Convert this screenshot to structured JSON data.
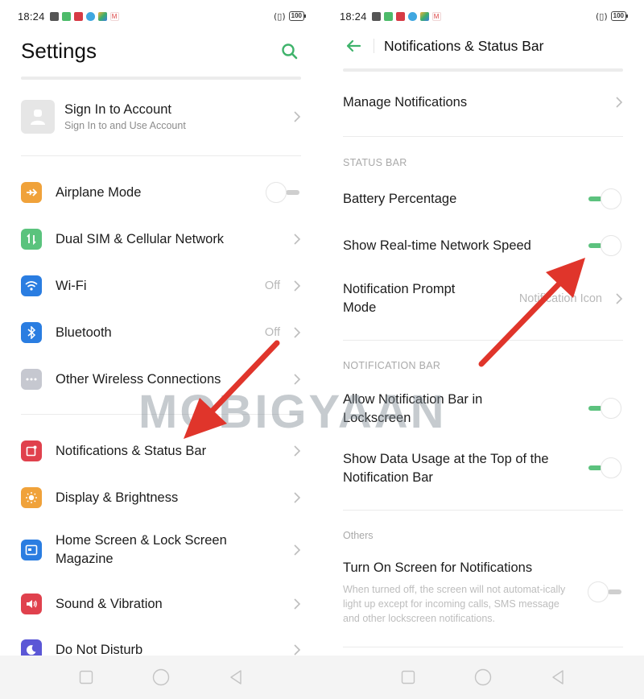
{
  "colors": {
    "accent_green": "#3fb36b",
    "toggle_on": "#5cc27e",
    "toggle_off": "#cfcfcf",
    "arrow_red": "#e0352b"
  },
  "status_bar": {
    "time": "18:24",
    "battery": "100",
    "vibrate_icon": "vibrate-icon",
    "notification_icons": [
      "close-box-icon",
      "green-app-icon",
      "red-app-icon",
      "shield-icon",
      "games-icon",
      "gmail-icon"
    ]
  },
  "left": {
    "title": "Settings",
    "search_icon": "search-icon",
    "account": {
      "title": "Sign In to Account",
      "subtitle": "Sign In to and Use Account"
    },
    "items": [
      {
        "label": "Airplane Mode",
        "icon": "airplane-icon",
        "color": "#f0a23a",
        "control": "toggle",
        "state": "off"
      },
      {
        "label": "Dual SIM & Cellular Network",
        "icon": "cellular-icon",
        "color": "#5ac37d",
        "control": "chevron"
      },
      {
        "label": "Wi-Fi",
        "icon": "wifi-icon",
        "color": "#2a7de1",
        "value": "Off",
        "control": "chevron"
      },
      {
        "label": "Bluetooth",
        "icon": "bluetooth-icon",
        "color": "#2a7de1",
        "value": "Off",
        "control": "chevron"
      },
      {
        "label": "Other Wireless Connections",
        "icon": "more-icon",
        "color": "#c6c8d0",
        "control": "chevron"
      },
      {
        "label": "Notifications & Status Bar",
        "icon": "notification-icon",
        "color": "#e0414d",
        "control": "chevron"
      },
      {
        "label": "Display & Brightness",
        "icon": "brightness-icon",
        "color": "#f0a23a",
        "control": "chevron"
      },
      {
        "label": "Home Screen & Lock Screen Magazine",
        "icon": "wallpaper-icon",
        "color": "#2a7de1",
        "control": "chevron"
      },
      {
        "label": "Sound & Vibration",
        "icon": "sound-icon",
        "color": "#e0414d",
        "control": "chevron"
      },
      {
        "label": "Do Not Disturb",
        "icon": "moon-icon",
        "color": "#5b57d6",
        "control": "chevron"
      }
    ]
  },
  "right": {
    "title": "Notifications & Status Bar",
    "back_icon": "back-arrow-icon",
    "manage": {
      "label": "Manage Notifications"
    },
    "sections": [
      {
        "header": "STATUS BAR",
        "items": [
          {
            "label": "Battery Percentage",
            "control": "toggle",
            "state": "on"
          },
          {
            "label": "Show Real-time Network Speed",
            "control": "toggle",
            "state": "on"
          },
          {
            "label": "Notification Prompt Mode",
            "value": "Notification Icon",
            "control": "chevron"
          }
        ]
      },
      {
        "header": "NOTIFICATION BAR",
        "items": [
          {
            "label": "Allow Notification Bar in Lockscreen",
            "control": "toggle",
            "state": "on"
          },
          {
            "label": "Show Data Usage at the Top of the Notification Bar",
            "control": "toggle",
            "state": "on"
          }
        ]
      },
      {
        "header": "Others",
        "items": [
          {
            "label": "Turn On Screen for Notifications",
            "description": "When turned off, the screen will not automat-ically light up except for incoming calls, SMS message and other lockscreen notifications.",
            "control": "toggle",
            "state": "off"
          }
        ]
      }
    ]
  },
  "navbar": {
    "recents": "recents-icon",
    "home": "home-icon",
    "back": "back-icon"
  },
  "watermark": "MOBIGYAAN"
}
